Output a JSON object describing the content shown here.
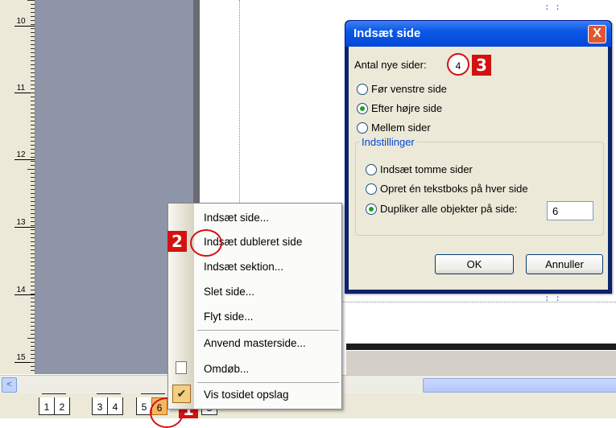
{
  "ruler": {
    "labels": [
      "10",
      "11",
      "12",
      "13",
      "14",
      "15"
    ]
  },
  "context_menu": {
    "items": [
      "Indsæt side...",
      "Indsæt dubleret side",
      "Indsæt sektion...",
      "Slet side...",
      "Flyt side...",
      "Anvend masterside...",
      "Omdøb...",
      "Vis tosidet opslag"
    ],
    "checked_item": "Vis tosidet opslag"
  },
  "dialog": {
    "title": "Indsæt side",
    "close_label": "X",
    "antal_label": "Antal nye sider:",
    "antal_value": "4",
    "position_options": [
      "Før venstre side",
      "Efter højre side",
      "Mellem sider"
    ],
    "position_selected": "Efter højre side",
    "group_label": "Indstillinger",
    "settings_options": [
      "Indsæt tomme sider",
      "Opret én tekstboks på hver side",
      "Dupliker alle objekter på side:"
    ],
    "settings_selected": "Dupliker alle objekter på side:",
    "duplicate_page_value": "6",
    "ok_label": "OK",
    "cancel_label": "Annuller"
  },
  "page_tabs": {
    "labels": [
      "1",
      "2",
      "3",
      "4",
      "5",
      "6",
      "8"
    ],
    "active": "6"
  },
  "callouts": [
    "1",
    "2",
    "3"
  ],
  "scroll_left_icon": "<",
  "colors": {
    "callout_red": "#d31111",
    "active_tab": "#f7b560",
    "title_blue": "#0a58e6"
  }
}
